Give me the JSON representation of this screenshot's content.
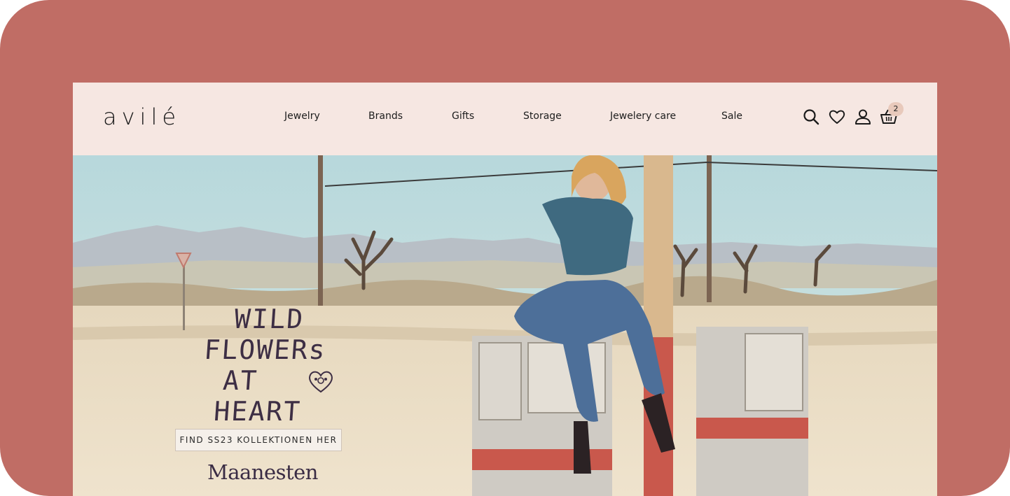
{
  "header": {
    "logo": "avilé",
    "nav": [
      "Jewelry",
      "Brands",
      "Gifts",
      "Storage",
      "Jewelery care",
      "Sale"
    ],
    "cart_count": "2",
    "icons": [
      "search-icon",
      "heart-icon",
      "user-icon",
      "basket-icon"
    ]
  },
  "hero": {
    "title_lines": [
      "WILD",
      "FLOWERs",
      "AT",
      "HEART"
    ],
    "cta_label": "FIND SS23 KOLLEKTIONEN HER",
    "brand": "Maanesten"
  },
  "colors": {
    "frame": "#c06d65",
    "header_bg": "#f6e7e2",
    "text": "#1d1d1d",
    "hero_title": "#3d2e44",
    "badge": "#e8c9bb"
  }
}
